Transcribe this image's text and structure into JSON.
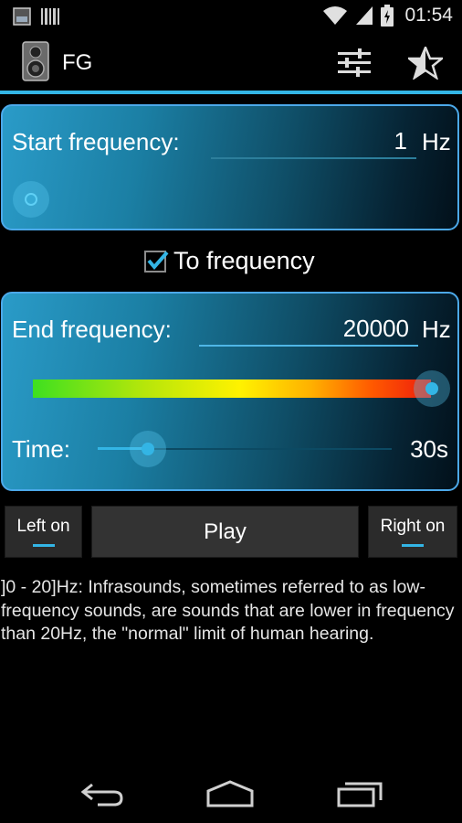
{
  "status_bar": {
    "time": "01:54",
    "icons": [
      "fg-notification-icon",
      "barcode-notification-icon",
      "wifi-icon",
      "signal-icon",
      "battery-icon"
    ]
  },
  "action_bar": {
    "title": "FG",
    "app_icon": "speaker-icon",
    "actions": [
      "equalizer-icon",
      "star-half-icon"
    ],
    "accent_color": "#33b5e5"
  },
  "start_panel": {
    "label": "Start frequency:",
    "value": "1",
    "unit": "Hz"
  },
  "to_frequency": {
    "label": "To frequency",
    "checked": true
  },
  "end_panel": {
    "label": "End frequency:",
    "value": "20000",
    "unit": "Hz",
    "time_label": "Time:",
    "time_value": "30s"
  },
  "controls": {
    "left_label": "Left on",
    "play_label": "Play",
    "right_label": "Right on"
  },
  "description": "]0 - 20]Hz: Infrasounds, sometimes referred to as low-frequency sounds, are sounds that are lower in frequency than 20Hz, the \"normal\" limit of human hearing.",
  "nav_bar": {
    "icons": [
      "back-icon",
      "home-icon",
      "recent-apps-icon"
    ]
  }
}
